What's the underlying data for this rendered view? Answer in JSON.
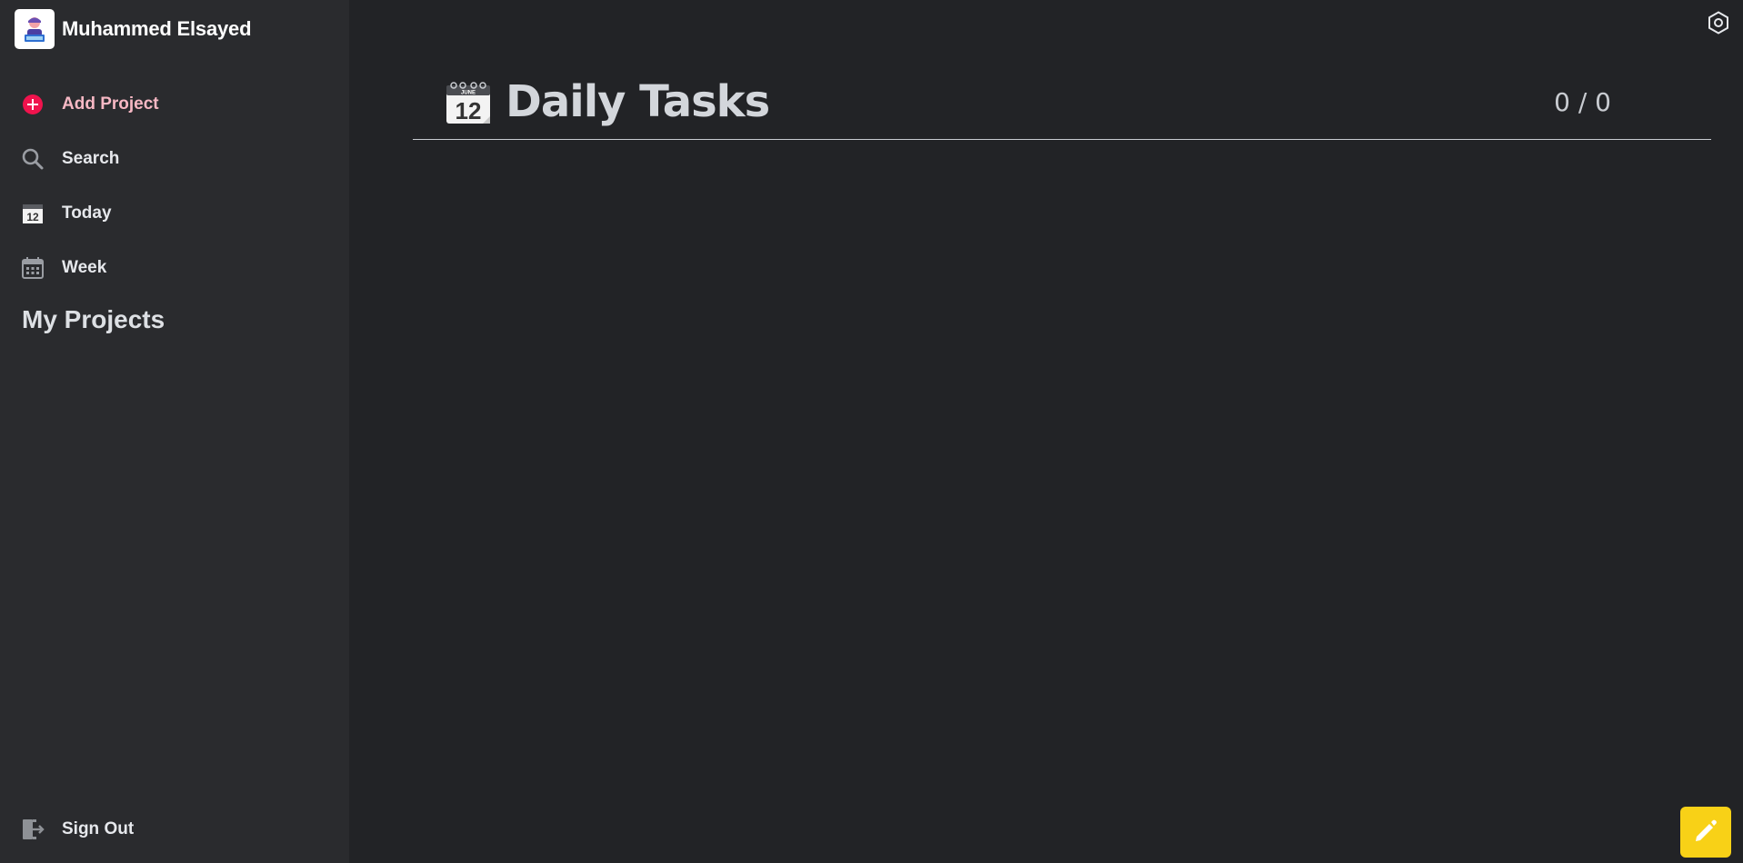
{
  "user": {
    "name": "Muhammed Elsayed",
    "avatar_icon": "user-avatar-icon"
  },
  "sidebar": {
    "items": [
      {
        "label": "Add Project",
        "icon": "add-circle-icon",
        "color": "#f0134d"
      },
      {
        "label": "Search",
        "icon": "search-icon"
      },
      {
        "label": "Today",
        "icon": "calendar-day-icon"
      },
      {
        "label": "Week",
        "icon": "calendar-week-icon"
      }
    ],
    "section_title": "My Projects",
    "signout_label": "Sign Out"
  },
  "main": {
    "title": "Daily Tasks",
    "title_icon": "calendar-12-icon",
    "progress": "0 / 0"
  },
  "settings_icon": "settings-hexagon-icon",
  "fab": {
    "icon": "pencil-icon",
    "color": "#f8d117"
  },
  "colors": {
    "background": "#222326",
    "sidebar": "#2a2b2e",
    "accent": "#f0134d"
  }
}
